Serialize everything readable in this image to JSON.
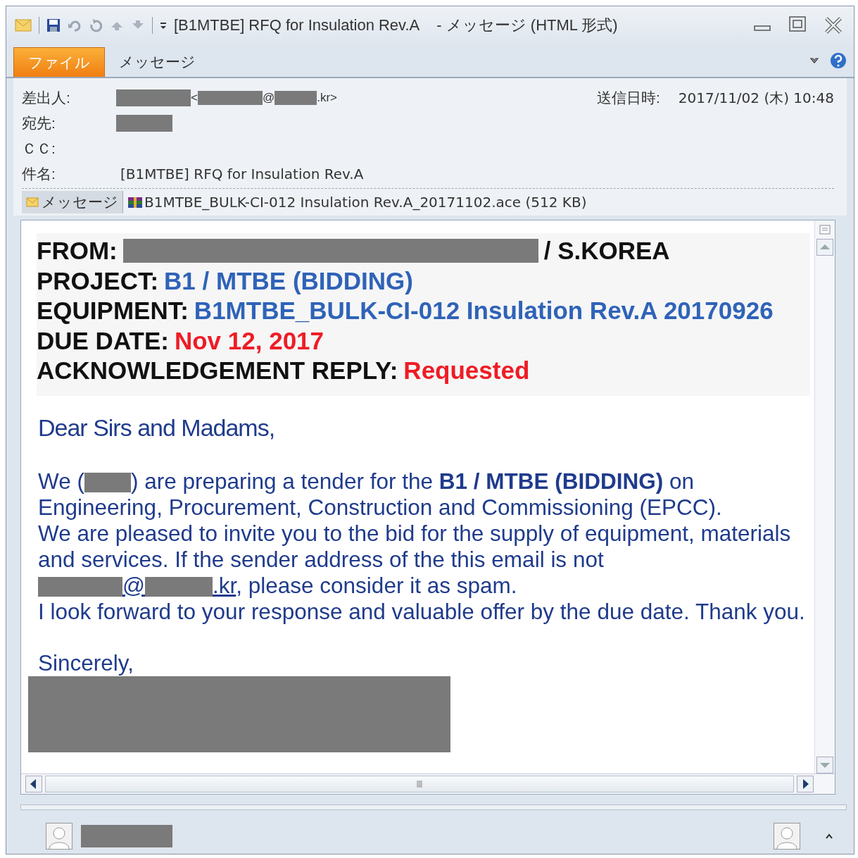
{
  "window": {
    "title": "[B1MTBE] RFQ for Insulation Rev.A",
    "subtitle": "- メッセージ (HTML 形式)"
  },
  "tabs": [
    {
      "label": "ファイル",
      "kind": "file"
    },
    {
      "label": "メッセージ",
      "kind": "tab"
    }
  ],
  "header": {
    "from": {
      "label": "差出人:",
      "open": "<",
      "at": "@",
      "close": ".kr>"
    },
    "sent": {
      "label": "送信日時:",
      "value": "2017/11/02 (木) 10:48"
    },
    "to": {
      "label": "宛先:"
    },
    "cc": {
      "label": "ＣＣ:"
    },
    "subject": {
      "label": "件名:",
      "value": "[B1MTBE] RFQ for Insulation Rev.A"
    }
  },
  "attachments": [
    {
      "label": "メッセージ",
      "kind": "message"
    },
    {
      "label": "B1MTBE_BULK-CI-012 Insulation Rev.A_20171102.ace (512 KB)",
      "kind": "archive"
    }
  ],
  "summary": [
    {
      "label": "FROM:",
      "value": "/ S.KOREA",
      "kind": "redacted"
    },
    {
      "label": "PROJECT:",
      "value": "B1 / MTBE (BIDDING)",
      "color": "#2f63b8"
    },
    {
      "label": "EQUIPMENT:",
      "value": "B1MTBE_BULK-CI-012 Insulation Rev.A 20170926",
      "color": "#2f63b8"
    },
    {
      "label": "DUE DATE:",
      "value": "Nov 12, 2017",
      "color": "#ee1c25"
    },
    {
      "label": "ACKNOWLEDGEMENT REPLY:",
      "value": "Requested",
      "color": "#ee1c25"
    }
  ],
  "body": {
    "greeting": "Dear Sirs and Madams,",
    "intro_before": "We (",
    "intro_after": ") are preparing a tender for the **B1 / MTBE (BIDDING)** on",
    "intro_end": "Engineering, Procurement, Construction and Commissioning (EPCC).",
    "invite": "We are pleased to invite you to the bid for the supply of equipment, materials",
    "invite_end": "and services. If the sender address of the this email is not",
    "link_at": "@",
    "link_end": ".kr",
    "spam": ", please consider it as spam.",
    "thanks": "I look forward to your response and valuable offer by the due date. Thank you.",
    "closing": "Sincerely,"
  }
}
